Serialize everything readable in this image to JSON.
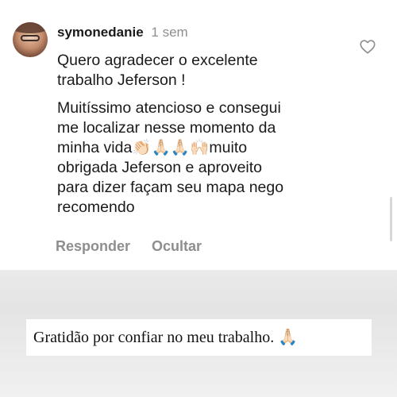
{
  "comment": {
    "username": "symonedanie",
    "time": "1 sem",
    "paragraph1": "Quero agradecer o excelente\ntrabalho Jeferson !",
    "paragraph2": "Muitíssimo atencioso e consegui\nme localizar nesse momento da\nminha vida👏🏻🙏🏻🙏🏻🙌🏻muito\nobrigada Jeferson e aproveito\npara dizer façam seu mapa nego\nrecomendo",
    "reply_label": "Responder",
    "hide_label": "Ocultar"
  },
  "caption": {
    "text": "Gratidão por confiar no meu trabalho. 🙏🏻"
  },
  "icons": {
    "like": "heart-icon",
    "avatar": "avatar"
  },
  "colors": {
    "muted_text": "#8e8e8e",
    "text": "#1a1a1a",
    "background_fade": "#e4e4e4"
  }
}
